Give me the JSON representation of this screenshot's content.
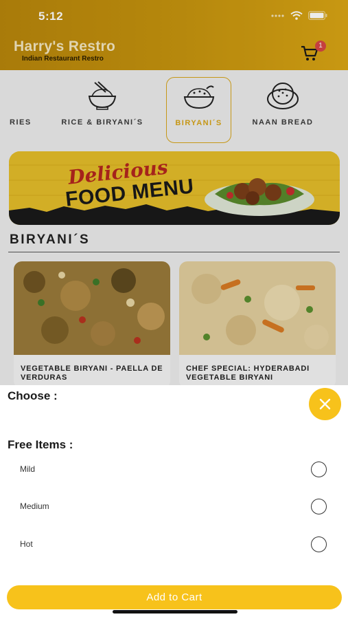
{
  "status": {
    "time": "5:12"
  },
  "header": {
    "title": "Harry's Restro",
    "subtitle": "Indian Restaurant Restro",
    "cart_count": "1"
  },
  "categories": [
    {
      "label": "RIES",
      "icon": "food-icon"
    },
    {
      "label": "RICE & BIRYANI´S",
      "icon": "rice-bowl-icon"
    },
    {
      "label": "BIRYANI´S",
      "icon": "biryani-bowl-icon",
      "active": true
    },
    {
      "label": "NAAN BREAD",
      "icon": "naan-bread-icon"
    }
  ],
  "banner": {
    "line1": "Delicious",
    "line2": "FOOD MENU"
  },
  "section": {
    "title": "BIRYANI´S"
  },
  "items": [
    {
      "name": "VEGETABLE BIRYANI - PAELLA DE VERDURAS"
    },
    {
      "name": "CHEF SPECIAL: HYDERABADI VEGETABLE BIRYANI"
    }
  ],
  "sheet": {
    "choose_label": "Choose :",
    "free_items_label": "Free Items :",
    "options": [
      {
        "label": "Mild"
      },
      {
        "label": "Medium"
      },
      {
        "label": "Hot"
      }
    ],
    "add_button": "Add to Cart"
  },
  "colors": {
    "accent": "#f7c21b",
    "header": "#c7950f",
    "badge": "#d64545"
  }
}
